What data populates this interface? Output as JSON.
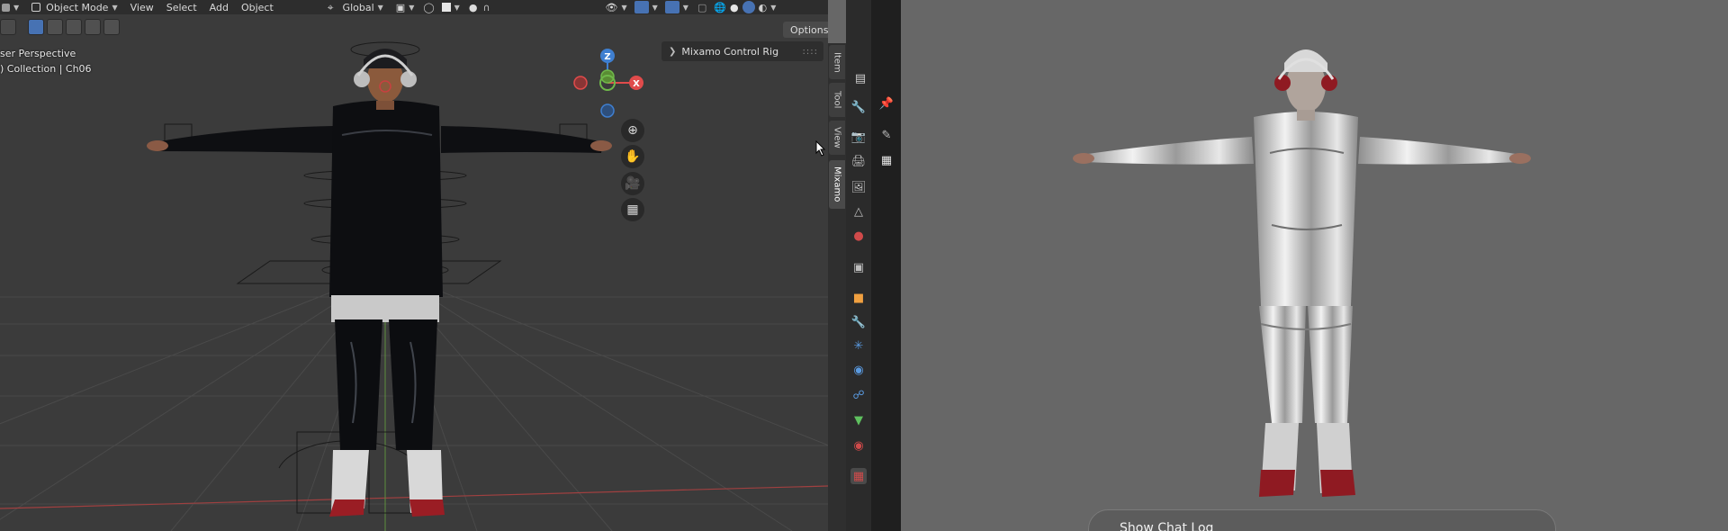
{
  "header": {
    "mode_label": "Object Mode",
    "menus": [
      "View",
      "Select",
      "Add",
      "Object"
    ],
    "transform_orientation": "Global"
  },
  "overlay": {
    "perspective_text": "ser Perspective",
    "collection_text": ") Collection | Ch06"
  },
  "options_label": "Options",
  "gizmo": {
    "z": "Z",
    "x": "X"
  },
  "npanel": {
    "panel_title": "Mixamo Control Rig"
  },
  "tabs": [
    "Item",
    "Tool",
    "View",
    "Mixamo"
  ],
  "chat": {
    "label": "Show Chat Log"
  },
  "colors": {
    "viewport_bg": "#3b3b3b",
    "header_bg": "#2d2d2d",
    "accent_blue": "#4772b3",
    "axis_red": "#e04b4b",
    "axis_green": "#6fb84a",
    "axis_blue": "#3f7fd0",
    "preview_bg": "#676767"
  }
}
